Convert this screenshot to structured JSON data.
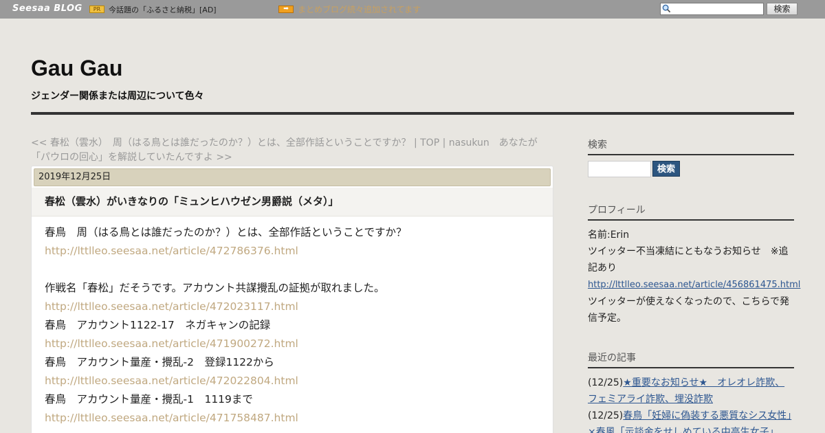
{
  "topbar": {
    "logo": "Seesaa BLOG",
    "pr_badge": "PR",
    "pr_text": "今話題の「ふるさと納税」[AD]",
    "arrow_badge": "➡",
    "matome": "まとめブログ続々追加されてます",
    "search_placeholder": "",
    "search_button": "検索"
  },
  "header": {
    "title": "Gau Gau",
    "description": "ジェンダー関係または周辺について色々"
  },
  "nav": {
    "prev_link": "<< 春松（雲水）　周（はる鳥とは誰だったのか？）とは、全部作話ということですか？",
    "sep1": " | ",
    "top": "TOP",
    "sep2": " | ",
    "next_link": "nasukun　あなたが「パウロの回心」を解説していたんですよ >>"
  },
  "post": {
    "date": "2019年12月25日",
    "title": "春松（雲水）がいきなりの「ミュンヒハウゼン男爵説（メタ）」",
    "body": [
      {
        "type": "text",
        "value": "春鳥　周（はる鳥とは誰だったのか？）とは、全部作話ということですか？"
      },
      {
        "type": "link",
        "value": "http://lttlleo.seesaa.net/article/472786376.html"
      },
      {
        "type": "blank",
        "value": ""
      },
      {
        "type": "text",
        "value": "作戦名「春松」だそうです。アカウント共謀攪乱の証拠が取れました。"
      },
      {
        "type": "link",
        "value": "http://lttlleo.seesaa.net/article/472023117.html"
      },
      {
        "type": "text",
        "value": "春鳥　アカウント1122-17　ネガキャンの記録"
      },
      {
        "type": "link",
        "value": "http://lttlleo.seesaa.net/article/471900272.html"
      },
      {
        "type": "text",
        "value": "春鳥　アカウント量産・攪乱-2　登録1122から"
      },
      {
        "type": "link",
        "value": "http://lttlleo.seesaa.net/article/472022804.html"
      },
      {
        "type": "text",
        "value": "春鳥　アカウント量産・攪乱-1　1119まで"
      },
      {
        "type": "link",
        "value": "http://lttlleo.seesaa.net/article/471758487.html"
      }
    ]
  },
  "sidebar": {
    "search": {
      "heading": "検索",
      "button": "検索"
    },
    "profile": {
      "heading": "プロフィール",
      "name": "名前:Erin",
      "notice": "ツイッター不当凍結にともなうお知らせ　※追記あり",
      "link": "http://lttlleo.seesaa.net/article/456861475.html",
      "note": "ツイッターが使えなくなったので、こちらで発信予定。"
    },
    "recent": {
      "heading": "最近の記事",
      "items": [
        {
          "date": "(12/25)",
          "title": "★重要なお知らせ★　オレオレ詐欺、フェミアライ詐欺、埋没詐欺"
        },
        {
          "date": "(12/25)",
          "title": "春鳥「妊婦に偽装する悪質なシス女性」×春風「示談金をせしめている中高生女子」"
        }
      ]
    }
  }
}
